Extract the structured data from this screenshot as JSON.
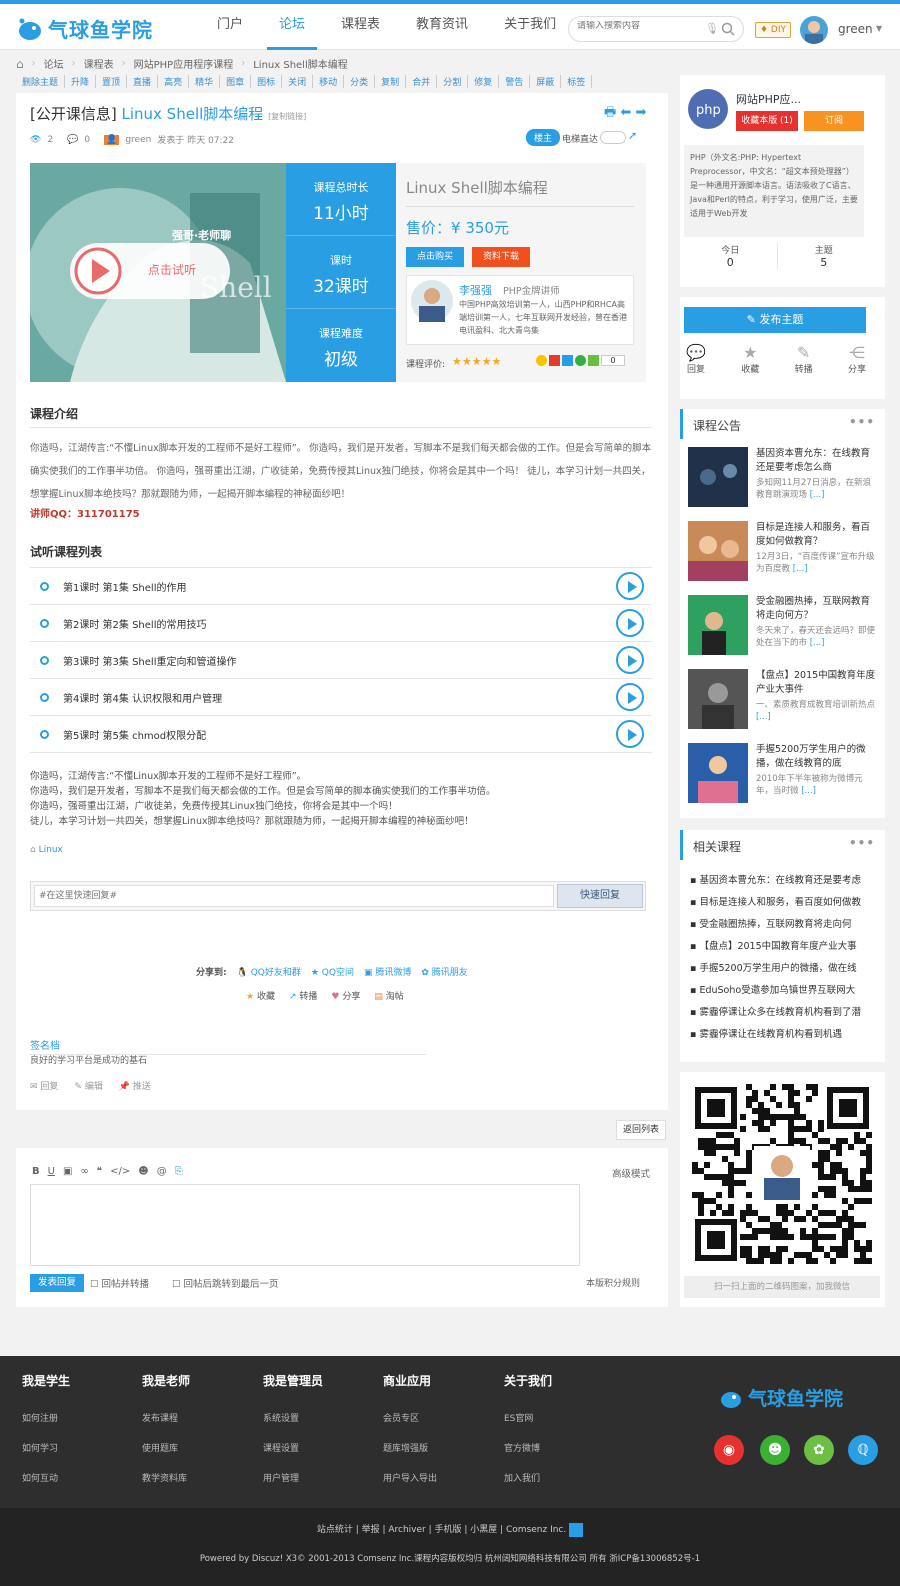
{
  "header": {
    "logo_text": "气球鱼学院",
    "nav": [
      "门户",
      "论坛",
      "课程表",
      "教育资讯",
      "关于我们"
    ],
    "active_nav": 1,
    "search_placeholder": "请输入搜索内容",
    "diy": "DIY",
    "username": "green"
  },
  "breadcrumb": [
    "论坛",
    "课程表",
    "网站PHP应用程序课程",
    "Linux Shell脚本编程"
  ],
  "mod_tools": [
    "删除主题",
    "升降",
    "置顶",
    "直播",
    "高亮",
    "精华",
    "图章",
    "图标",
    "关闭",
    "移动",
    "分类",
    "复制",
    "合并",
    "分割",
    "修复",
    "警告",
    "屏蔽",
    "标签"
  ],
  "thread": {
    "prefix": "[公开课信息]",
    "title": "Linux Shell脚本编程",
    "copy_link": "[复制链接]",
    "views": "2",
    "replies": "0",
    "author": "green",
    "posted": "发表于 昨天 07:22",
    "owner_badge": "楼主",
    "direct": "电梯直达"
  },
  "course": {
    "banner_title": "强哥·老师聊",
    "banner_word": "Shell",
    "trial": "点击试听",
    "duration_label": "课程总时长",
    "duration": "11小时",
    "hours_label": "课时",
    "hours": "32课时",
    "level_label": "课程难度",
    "level": "初级",
    "name": "Linux Shell脚本编程",
    "price_label": "售价：",
    "price": "¥ 350元",
    "buy": "点击购买",
    "download": "资料下载",
    "teacher_name": "李强强",
    "teacher_title": "PHP金牌讲师",
    "teacher_desc": "中国PHP高效培训第一人，山西PHP和RHCA高端培训第一人，七年互联网开发经验，曾在香港电讯盈科、北大青鸟集",
    "rating_label": "课程评价:",
    "rating": 5,
    "share_count": "0"
  },
  "intro": {
    "heading": "课程介绍",
    "text": "你造吗，江湖传言:“不懂Linux脚本开发的工程师不是好工程师”。 你造吗，我们是开发者，写脚本不是我们每天都会做的工作。但是会写简单的脚本确实使我们的工作事半功倍。 你造吗，强哥重出江湖，广收徒弟，免费传授其Linux独门绝技，你将会是其中一个吗！ 徒儿，本学习计划一共四关，想掌握Linux脚本绝技吗？那就跟随为师，一起揭开脚本编程的神秘面纱吧！",
    "qq": "讲师QQ：311701175"
  },
  "lessons": {
    "heading": "试听课程列表",
    "items": [
      "第1课时 第1集 Shell的作用",
      "第2课时 第2集 Shell的常用技巧",
      "第3课时 第3集 Shell重定向和管道操作",
      "第4课时 第4集 认识权限和用户管理",
      "第5课时 第5集 chmod权限分配"
    ]
  },
  "body_text": [
    "你造吗，江湖传言:“不懂Linux脚本开发的工程师不是好工程师”。",
    "你造吗，我们是开发者，写脚本不是我们每天都会做的工作。但是会写简单的脚本确实使我们的工作事半功倍。",
    "你造吗，强哥重出江湖，广收徒弟，免费传授其Linux独门绝技，你将会是其中一个吗！",
    "徒儿，本学习计划一共四关，想掌握Linux脚本绝技吗？那就跟随为师，一起揭开脚本编程的神秘面纱吧！"
  ],
  "tag": "Linux",
  "quick_reply": {
    "placeholder": "#在这里快速回复#",
    "button": "快速回复"
  },
  "share": {
    "label": "分享到:",
    "items": [
      "QQ好友和群",
      "QQ空间",
      "腾讯微博",
      "腾讯朋友"
    ]
  },
  "actions": [
    "收藏",
    "转播",
    "分享",
    "淘帖"
  ],
  "signature": {
    "heading": "签名档",
    "text": "良好的学习平台是成功的基石"
  },
  "post_actions": [
    "回复",
    "编辑",
    "推送"
  ],
  "back_list": "返回列表",
  "editor": {
    "advanced": "高级模式",
    "submit": "发表回复",
    "opt1": "回帖并转播",
    "opt2": "回帖后跳转到最后一页",
    "rules": "本版积分规则"
  },
  "forum_info": {
    "name": "网站PHP应...",
    "fav": "收藏本版 (1)",
    "subscribe": "订阅",
    "desc": "PHP（外文名:PHP: Hypertext Preprocessor，中文名：“超文本预处理器”）是一种通用开源脚本语言。语法吸收了C语言、Java和Perl的特点，利于学习，使用广泛，主要适用于Web开发",
    "today_label": "今日",
    "today": "0",
    "topics_label": "主题",
    "topics": "5"
  },
  "post_panel": {
    "new_topic": "发布主题",
    "items": [
      "回复",
      "收藏",
      "转播",
      "分享"
    ]
  },
  "notices": {
    "heading": "课程公告",
    "items": [
      {
        "title": "基因资本曹允东：在线教育还是要考虑怎么商",
        "desc": "多知网11月27日消息，在新浪教育跳演现场",
        "more": "[...]"
      },
      {
        "title": "目标是连接人和服务，看百度如何做教育？",
        "desc": "12月3日，“百度传课”宣布升级为百度教",
        "more": "[...]"
      },
      {
        "title": "受金融圈热捧，互联网教育将走向何方？",
        "desc": "冬天来了，春天还会远吗？即便处在当下的市",
        "more": "[...]"
      },
      {
        "title": "【盘点】2015中国教育年度产业大事件",
        "desc": "一、素质教育成教育培训新热点",
        "more": "[...]"
      },
      {
        "title": "手握5200万学生用户的微播，做在线教育的底",
        "desc": "2010年下半年被称为微博元年，当时微",
        "more": "[...]"
      }
    ]
  },
  "related": {
    "heading": "相关课程",
    "items": [
      "基因资本曹允东：在线教育还是要考虑",
      "目标是连接人和服务，看百度如何做教",
      "受金融圈热捧，互联网教育将走向何",
      "【盘点】2015中国教育年度产业大事",
      "手握5200万学生用户的微播，做在线",
      "EduSoho受邀参加乌镇世界互联网大",
      "雾霾停课让众多在线教育机构看到了潜",
      "雾霾停课让在线教育机构看到机遇"
    ]
  },
  "qr_caption": "扫一扫上面的二维码图案，加我微信",
  "footer": {
    "cols": [
      {
        "h": "我是学生",
        "links": [
          "如何注册",
          "如何学习",
          "如何互动"
        ]
      },
      {
        "h": "我是老师",
        "links": [
          "发布课程",
          "使用题库",
          "教学资料库"
        ]
      },
      {
        "h": "我是管理员",
        "links": [
          "系统设置",
          "课程设置",
          "用户管理"
        ]
      },
      {
        "h": "商业应用",
        "links": [
          "会员专区",
          "题库增强版",
          "用户导入导出"
        ]
      },
      {
        "h": "关于我们",
        "links": [
          "ES官网",
          "官方微博",
          "加入我们"
        ]
      }
    ],
    "logo": "气球鱼学院",
    "links": "站点统计 | 举报 | Archiver | 手机版 | 小黑屋 |  Comsenz Inc.",
    "copyright": "Powered by Discuz! X3© 2001-2013 Comsenz Inc.课程内容版权均归 杭州阔知网络科技有限公司 所有 浙ICP备13006852号-1"
  }
}
